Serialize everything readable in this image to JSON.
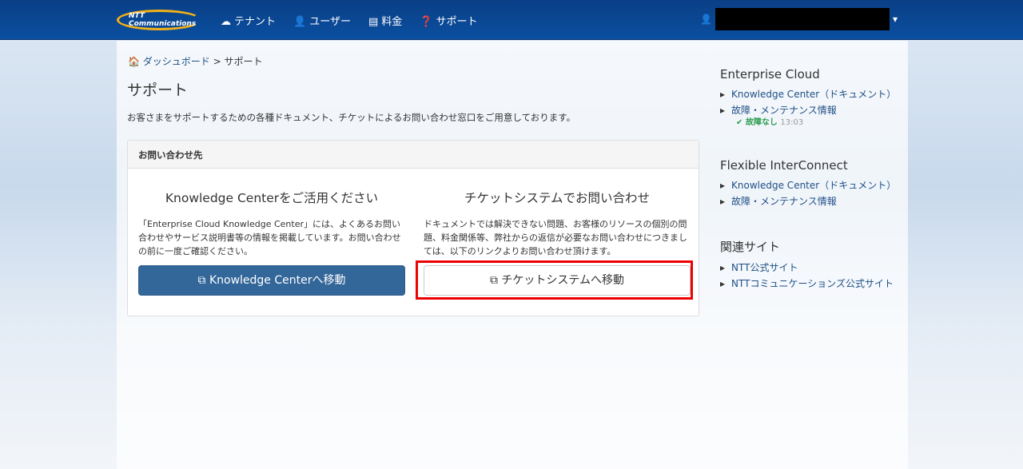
{
  "nav": {
    "logo": "NTT Communications",
    "items": [
      {
        "icon": "cloud-icon",
        "label": "テナント"
      },
      {
        "icon": "user-icon",
        "label": "ユーザー"
      },
      {
        "icon": "card-icon",
        "label": "料金"
      },
      {
        "icon": "question-icon",
        "label": "サポート"
      }
    ]
  },
  "breadcrumb": {
    "home": "ダッシュボード",
    "sep": ">",
    "current": "サポート"
  },
  "title": "サポート",
  "description": "お客さまをサポートするための各種ドキュメント、チケットによるお問い合わせ窓口をご用意しております。",
  "panel": {
    "heading": "お問い合わせ先",
    "kc": {
      "title": "Knowledge Centerをご活用ください",
      "text": "「Enterprise Cloud Knowledge Center」には、よくあるお問い合わせやサービス説明書等の情報を掲載しています。お問い合わせの前に一度ご確認ください。",
      "button": "Knowledge Centerへ移動"
    },
    "ticket": {
      "title": "チケットシステムでお問い合わせ",
      "text": "ドキュメントでは解決できない問題、お客様のリソースの個別の問題、料金関係等、弊社からの返信が必要なお問い合わせにつきましては、以下のリンクよりお問い合わせ頂けます。",
      "button": "チケットシステムへ移動"
    }
  },
  "sidebar": [
    {
      "title": "Enterprise Cloud",
      "links": [
        "Knowledge Center（ドキュメント）",
        "故障・メンテナンス情報"
      ],
      "status": "故障なし",
      "time": "13:03"
    },
    {
      "title": "Flexible InterConnect",
      "links": [
        "Knowledge Center（ドキュメント）",
        "故障・メンテナンス情報"
      ]
    },
    {
      "title": "関連サイト",
      "links": [
        "NTT公式サイト",
        "NTTコミュニケーションズ公式サイト"
      ]
    }
  ]
}
